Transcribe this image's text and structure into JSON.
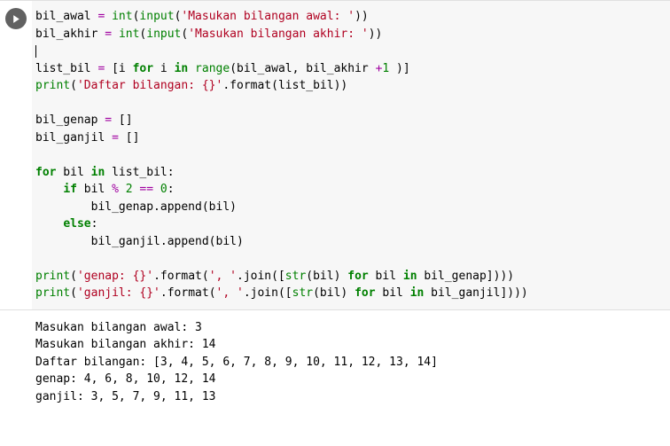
{
  "code": {
    "l1": {
      "v1": "bil_awal ",
      "op1": "=",
      "sp1": " ",
      "fn1": "int",
      "p1": "(",
      "fn2": "input",
      "p2": "(",
      "str1": "'Masukan bilangan awal: '",
      "p3": "))"
    },
    "l2": {
      "v1": "bil_akhir ",
      "op1": "=",
      "sp1": " ",
      "fn1": "int",
      "p1": "(",
      "fn2": "input",
      "p2": "(",
      "str1": "'Masukan bilangan akhir: '",
      "p3": "))"
    },
    "l3": "",
    "l4": {
      "v1": "list_bil ",
      "op1": "=",
      "sp1": " [i ",
      "kw1": "for",
      "sp2": " i ",
      "kw2": "in",
      "sp3": " ",
      "fn1": "range",
      "p1": "(bil_awal, bil_akhir ",
      "op2": "+",
      "num1": "1",
      "sp4": " )]"
    },
    "l5": {
      "fn1": "print",
      "p1": "(",
      "str1": "'Daftar bilangan: {}'",
      "p2": ".",
      "fn2": "format",
      "p3": "(list_bil))"
    },
    "l6": "",
    "l7": {
      "v1": "bil_genap ",
      "op1": "=",
      "v2": " []"
    },
    "l8": {
      "v1": "bil_ganjil ",
      "op1": "=",
      "v2": " []"
    },
    "l9": "",
    "l10": {
      "kw1": "for",
      "v1": " bil ",
      "kw2": "in",
      "v2": " list_bil:"
    },
    "l11": {
      "sp1": "    ",
      "kw1": "if",
      "v1": " bil ",
      "op1": "%",
      "sp2": " ",
      "num1": "2",
      "sp3": " ",
      "op2": "==",
      "sp4": " ",
      "num2": "0",
      "v2": ":"
    },
    "l12": {
      "sp1": "        bil_genap.append(bil)"
    },
    "l13": {
      "sp1": "    ",
      "kw1": "else",
      "v1": ":"
    },
    "l14": {
      "sp1": "        bil_ganjil.append(bil)"
    },
    "l15": "",
    "l16": {
      "fn1": "print",
      "p1": "(",
      "str1": "'genap: {}'",
      "p2": ".",
      "fn2": "format",
      "p3": "(",
      "str2": "', '",
      "p4": ".join([",
      "fn3": "str",
      "p5": "(bil) ",
      "kw1": "for",
      "sp1": " bil ",
      "kw2": "in",
      "sp2": " bil_genap])))"
    },
    "l17": {
      "fn1": "print",
      "p1": "(",
      "str1": "'ganjil: {}'",
      "p2": ".",
      "fn2": "format",
      "p3": "(",
      "str2": "', '",
      "p4": ".join([",
      "fn3": "str",
      "p5": "(bil) ",
      "kw1": "for",
      "sp1": " bil ",
      "kw2": "in",
      "sp2": " bil_ganjil])))"
    }
  },
  "output": {
    "o1": "Masukan bilangan awal: 3",
    "o2": "Masukan bilangan akhir: 14",
    "o3": "Daftar bilangan: [3, 4, 5, 6, 7, 8, 9, 10, 11, 12, 13, 14]",
    "o4": "genap: 4, 6, 8, 10, 12, 14",
    "o5": "ganjil: 3, 5, 7, 9, 11, 13"
  }
}
